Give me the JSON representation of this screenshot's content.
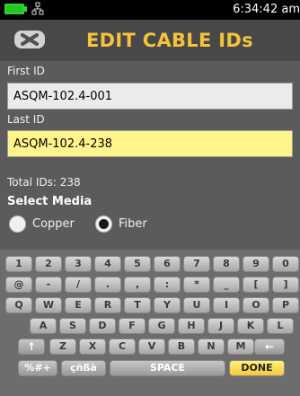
{
  "status_bar": {
    "time": "6:34:42 am",
    "battery_color": "#25c525"
  },
  "header": {
    "title": "EDIT CABLE IDs",
    "back_icon": "back-x-icon"
  },
  "form": {
    "first_id_label": "First ID",
    "first_id_value": "ASQM-102.4-001",
    "last_id_label": "Last ID",
    "last_id_value": "ASQM-102.4-238",
    "total_ids": "Total IDs: 238",
    "select_media_label": "Select Media",
    "media_options": [
      {
        "label": "Copper",
        "selected": false
      },
      {
        "label": "Fiber",
        "selected": true
      }
    ]
  },
  "keyboard": {
    "rows": [
      [
        "1",
        "2",
        "3",
        "4",
        "5",
        "6",
        "7",
        "8",
        "9",
        "0"
      ],
      [
        "@",
        "-",
        "/",
        ".",
        ",",
        ":",
        "*",
        "_",
        "[",
        "]"
      ],
      [
        "Q",
        "W",
        "E",
        "R",
        "T",
        "Y",
        "U",
        "I",
        "O",
        "P"
      ],
      [
        "A",
        "S",
        "D",
        "F",
        "G",
        "H",
        "J",
        "K",
        "L"
      ],
      [
        "Z",
        "X",
        "C",
        "V",
        "B",
        "N",
        "M"
      ]
    ],
    "shift_label": "↑",
    "backspace_label": "←",
    "symbols_label": "%#+",
    "accents_label": "çñßà",
    "space_label": "SPACE",
    "done_label": "DONE"
  }
}
